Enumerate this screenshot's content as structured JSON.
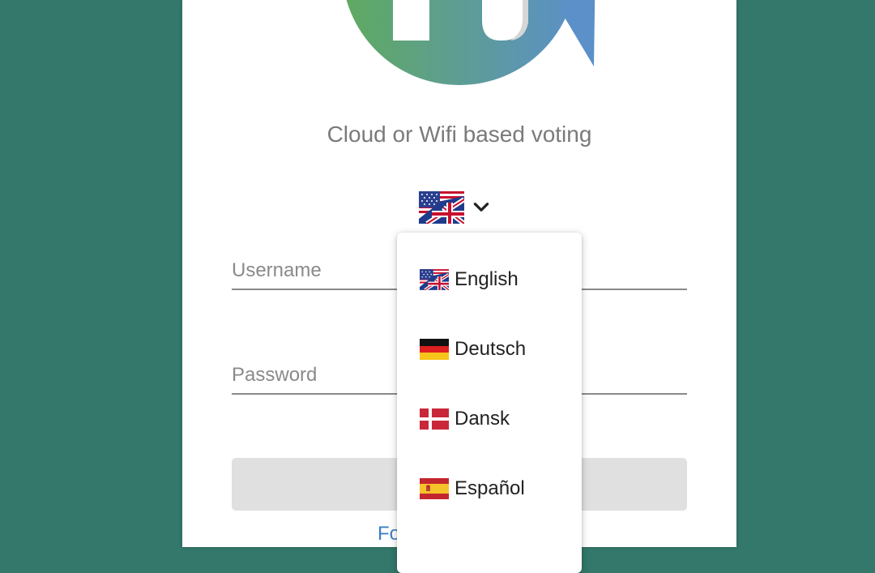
{
  "tagline": "Cloud or Wifi based voting",
  "language_selector": {
    "selected_flag": "us-uk-flag-icon",
    "toggle_icon": "chevron-down-icon"
  },
  "form": {
    "username_placeholder": "Username",
    "password_placeholder": "Password",
    "forgot_link_partial": "Fo"
  },
  "language_menu": {
    "items": [
      {
        "label": "English",
        "flag": "us-uk-flag-icon"
      },
      {
        "label": "Deutsch",
        "flag": "germany-flag-icon"
      },
      {
        "label": "Dansk",
        "flag": "denmark-flag-icon"
      },
      {
        "label": "Español",
        "flag": "spain-flag-icon"
      }
    ]
  },
  "colors": {
    "background": "#33786a",
    "card": "#ffffff",
    "link": "#3d7fc4",
    "logo_gradient_start": "#5faa5f",
    "logo_gradient_end": "#5b90c8"
  }
}
